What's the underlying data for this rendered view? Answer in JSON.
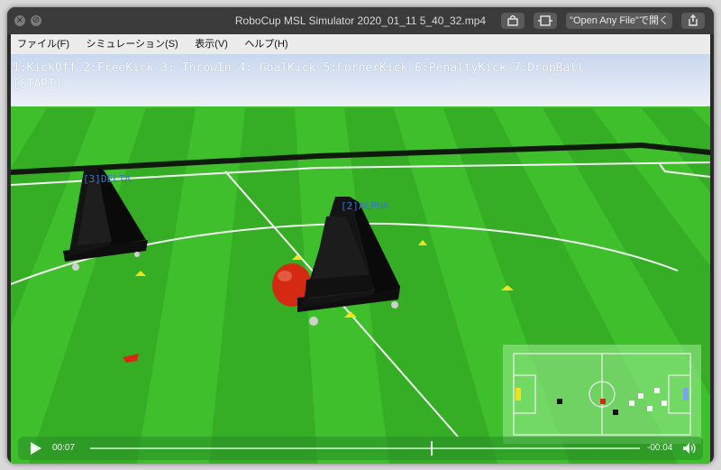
{
  "window": {
    "title": "RoboCup MSL Simulator 2020_01_11 5_40_32.mp4",
    "open_any_file_label": "\"Open Any File\"で開く"
  },
  "menu": {
    "items": [
      "ファイル(F)",
      "シミュレーション(S)",
      "表示(V)",
      "ヘルプ(H)"
    ]
  },
  "sim": {
    "commands": "1:KickOff 2:FreeKick 3: ThrowIn 4: GoalKick 5:CornerKick 6:PenaltyKick 7:DropBall",
    "status": "[START]",
    "robots": [
      {
        "label": "[3]DELTA"
      },
      {
        "label": "[2]ALPHA"
      }
    ]
  },
  "player": {
    "elapsed": "00:07",
    "remaining": "-00:04",
    "progress": 0.62
  },
  "colors": {
    "field_light": "#3fbf2c",
    "field_dark": "#2ea61f",
    "ball": "#d42a14",
    "label_blue": "#3b74d6"
  }
}
